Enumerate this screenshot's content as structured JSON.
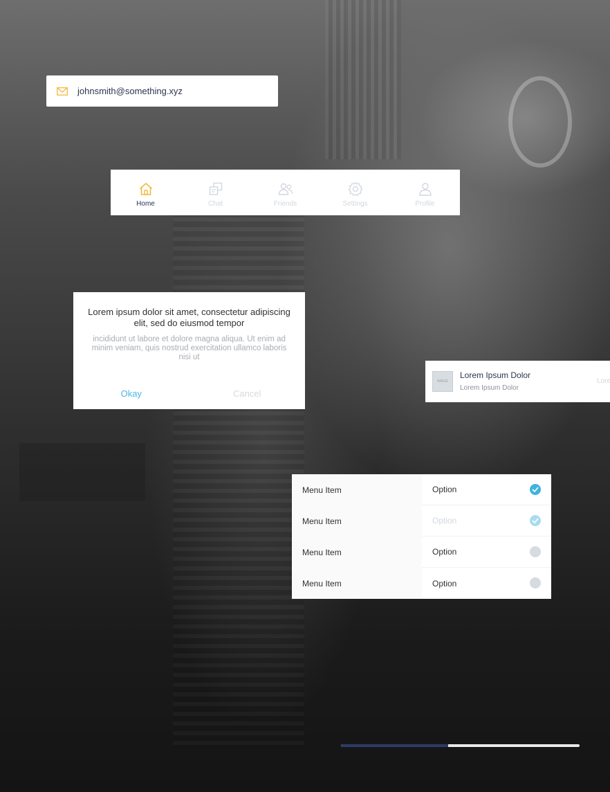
{
  "colors": {
    "accent": "#f5b83d",
    "navy": "#2d3450",
    "check": "#3fb3de",
    "muted": "#d2d7df"
  },
  "email": {
    "value": "johnsmith@something.xyz",
    "icon": "mail-icon"
  },
  "tabs": [
    {
      "label": "Home",
      "icon": "home-icon",
      "active": true
    },
    {
      "label": "Chat",
      "icon": "chat-icon",
      "active": false
    },
    {
      "label": "Friends",
      "icon": "friends-icon",
      "active": false
    },
    {
      "label": "Settings",
      "icon": "gear-icon",
      "active": false
    },
    {
      "label": "Profile",
      "icon": "user-icon",
      "active": false
    }
  ],
  "dialog": {
    "title": "Lorem ipsum dolor sit amet, consectetur adipiscing elit, sed do eiusmod tempor",
    "body": "incididunt ut labore et dolore magna aliqua. Ut enim ad minim veniam, quis nostrud exercitation ullamco laboris nisi ut",
    "ok_label": "Okay",
    "cancel_label": "Cancel"
  },
  "list_item": {
    "thumb_label": "IMAGE",
    "title": "Lorem Ipsum Dolor",
    "subtitle": "Lorem Ipsum Dolor",
    "trailing": "Lore"
  },
  "menu": {
    "rows": [
      {
        "label": "Menu Item",
        "option": "Option",
        "state": "checked"
      },
      {
        "label": "Menu Item",
        "option": "Option",
        "state": "checked-light"
      },
      {
        "label": "Menu Item",
        "option": "Option",
        "state": "empty"
      },
      {
        "label": "Menu Item",
        "option": "Option",
        "state": "empty"
      }
    ]
  },
  "progress": {
    "value": 0.45
  }
}
